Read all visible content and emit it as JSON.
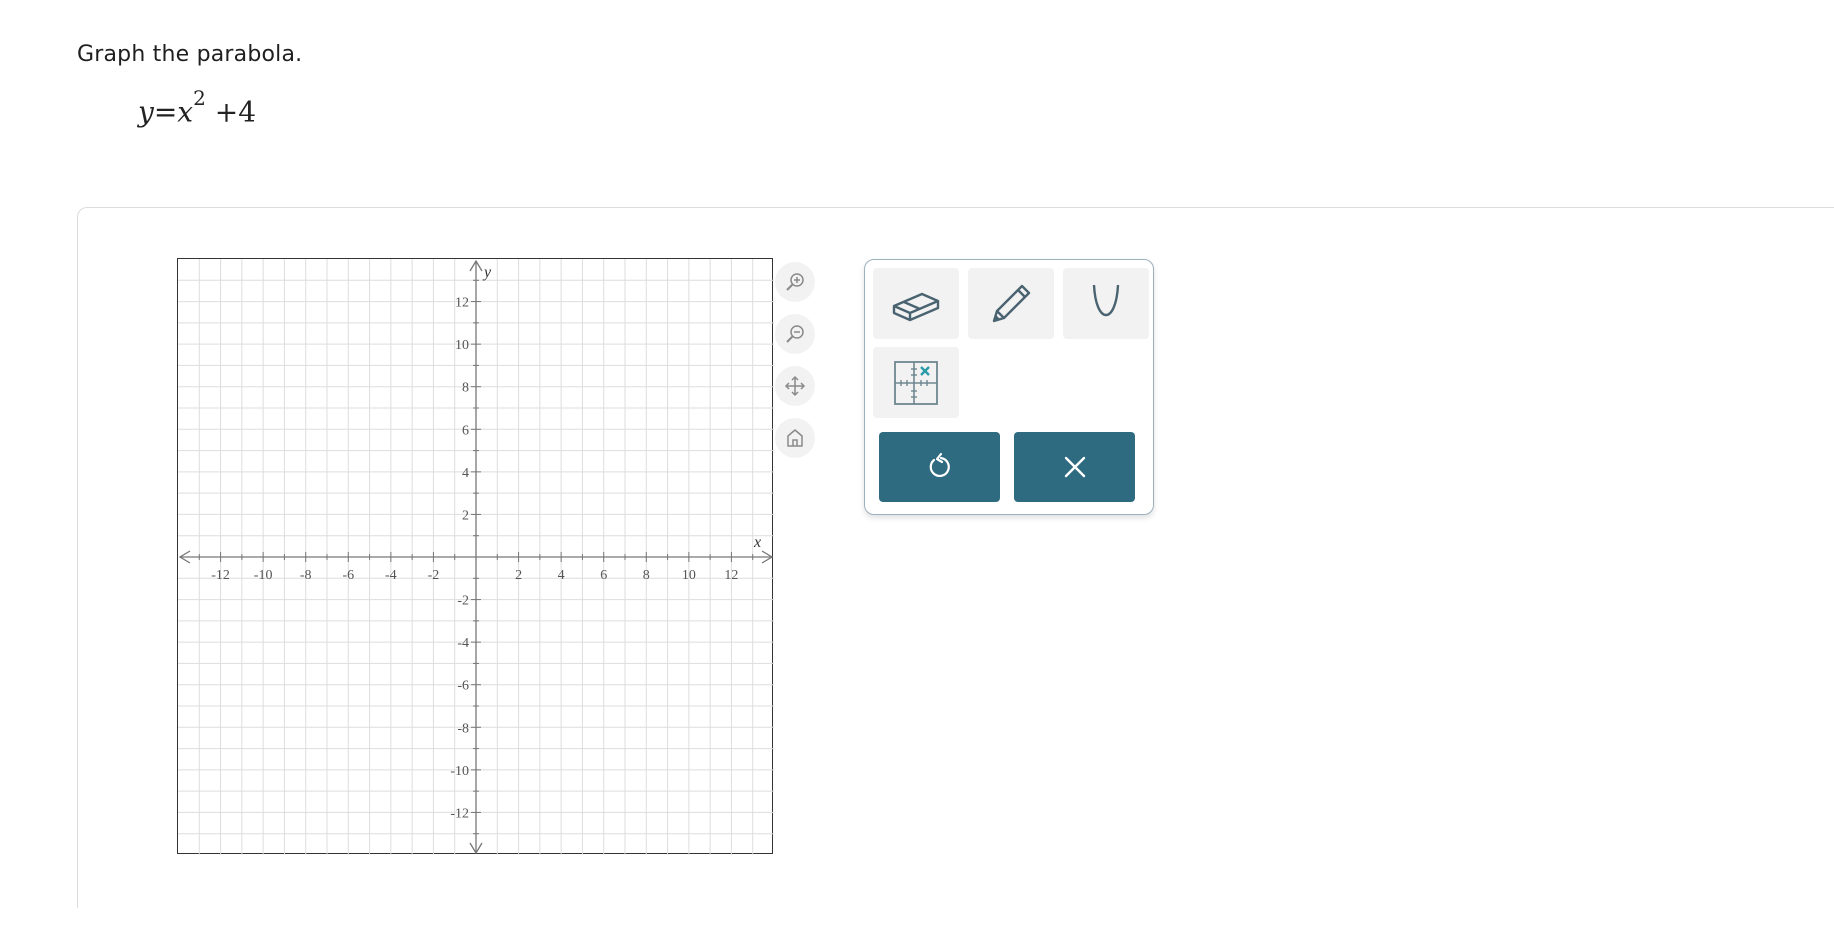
{
  "question": {
    "instruction": "Graph the parabola.",
    "equation": {
      "lhs": "y",
      "equals": "=",
      "base": "x",
      "exponent": "2",
      "rest": " +4"
    }
  },
  "graph": {
    "x_axis_label": "x",
    "y_axis_label": "y",
    "x_range": [
      -14,
      14
    ],
    "y_range": [
      -14,
      14
    ],
    "x_tick_labels": [
      "-12",
      "-10",
      "-8",
      "-6",
      "-4",
      "-2",
      "2",
      "4",
      "6",
      "8",
      "10",
      "12"
    ],
    "y_tick_labels": [
      "12",
      "10",
      "8",
      "6",
      "4",
      "2",
      "-2",
      "-4",
      "-6",
      "-8",
      "-10",
      "-12"
    ],
    "grid": true,
    "colors": {
      "grid": "#dddddd",
      "axis": "#777777",
      "label": "#555555"
    }
  },
  "zoom_controls": {
    "items": [
      "zoom-in-icon",
      "zoom-out-icon",
      "pan-icon",
      "home-icon"
    ]
  },
  "tools": {
    "items": [
      "eraser-icon",
      "pencil-icon",
      "parabola-icon",
      "point-plot-icon"
    ],
    "actions": [
      "undo-icon",
      "clear-icon"
    ],
    "colors": {
      "accent": "#2e6a80",
      "icon": "#4a6370",
      "highlight": "#2a9aa8"
    }
  }
}
